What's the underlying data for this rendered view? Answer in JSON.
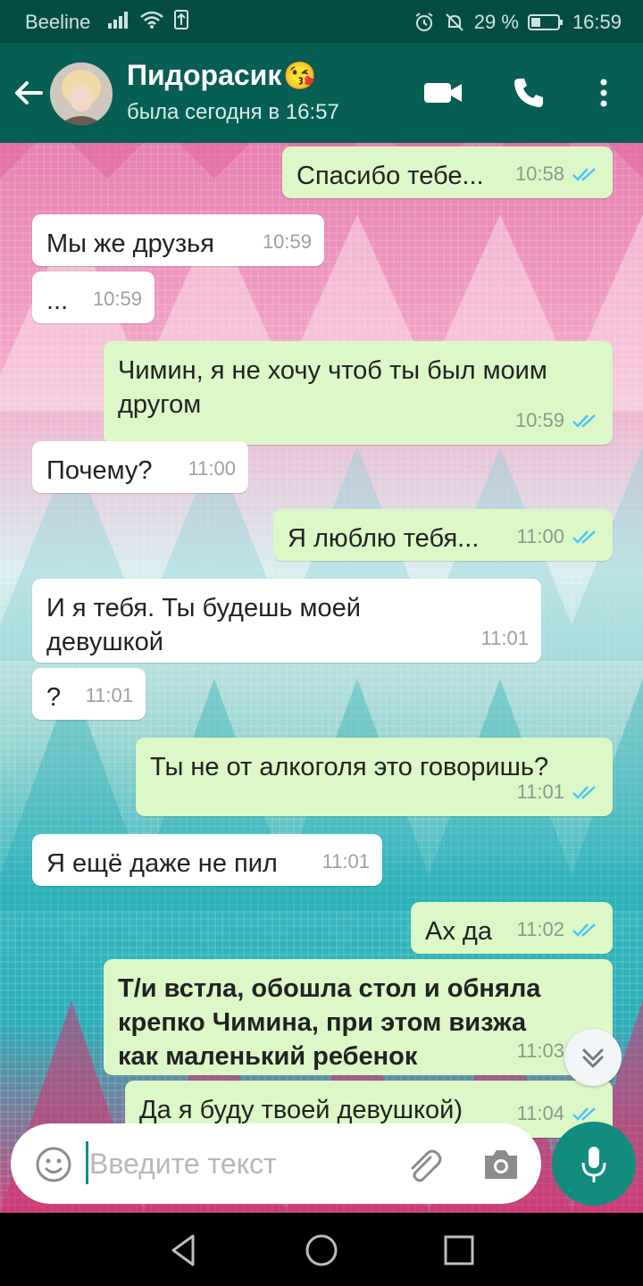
{
  "status_bar": {
    "carrier": "Beeline",
    "battery_percent": "29 %",
    "time": "16:59"
  },
  "header": {
    "contact_name": "Пидорасик",
    "contact_emoji": "😘",
    "last_seen": "была сегодня в 16:57"
  },
  "messages": [
    {
      "dir": "out",
      "text": "Спасибо тебе...",
      "time": "10:58",
      "read": true
    },
    {
      "dir": "in",
      "text": "Мы же друзья",
      "time": "10:59"
    },
    {
      "dir": "in",
      "text": "...",
      "time": "10:59"
    },
    {
      "dir": "out",
      "text": "Чимин, я не хочу чтоб ты был моим другом",
      "time": "10:59",
      "read": true
    },
    {
      "dir": "in",
      "text": "Почему?",
      "time": "11:00"
    },
    {
      "dir": "out",
      "text": "Я люблю тебя...",
      "time": "11:00",
      "read": true
    },
    {
      "dir": "in",
      "text": "И я тебя. Ты будешь моей девушкой",
      "time": "11:01"
    },
    {
      "dir": "in",
      "text": "?",
      "time": "11:01"
    },
    {
      "dir": "out",
      "text": "Ты не от алкоголя это говоришь?",
      "time": "11:01",
      "read": true
    },
    {
      "dir": "in",
      "text": "Я ещё даже не пил",
      "time": "11:01"
    },
    {
      "dir": "out",
      "text": "Ах да",
      "time": "11:02",
      "read": true
    },
    {
      "dir": "out",
      "text": "Т/и встла, обошла стол и обняла крепко Чимина, при этом визжа как маленький ребенок",
      "time": "11:03",
      "read": true
    },
    {
      "dir": "out",
      "text": "Да я буду твоей девушкой)",
      "time": "11:04",
      "read": true
    }
  ],
  "composer": {
    "placeholder": "Введите текст"
  },
  "icons": {
    "back": "arrow-left-icon",
    "video": "video-camera-icon",
    "call": "phone-icon",
    "more": "more-vertical-icon",
    "emoji": "smiley-icon",
    "attach": "paperclip-icon",
    "camera": "camera-icon",
    "mic": "microphone-icon",
    "scroll": "chevron-double-down-icon"
  },
  "colors": {
    "header": "#075e54",
    "status_bar": "#054d44",
    "outgoing_bubble": "#dcf8c6",
    "incoming_bubble": "#ffffff",
    "accent": "#128c7e",
    "read_ticks": "#4fc3f7"
  }
}
